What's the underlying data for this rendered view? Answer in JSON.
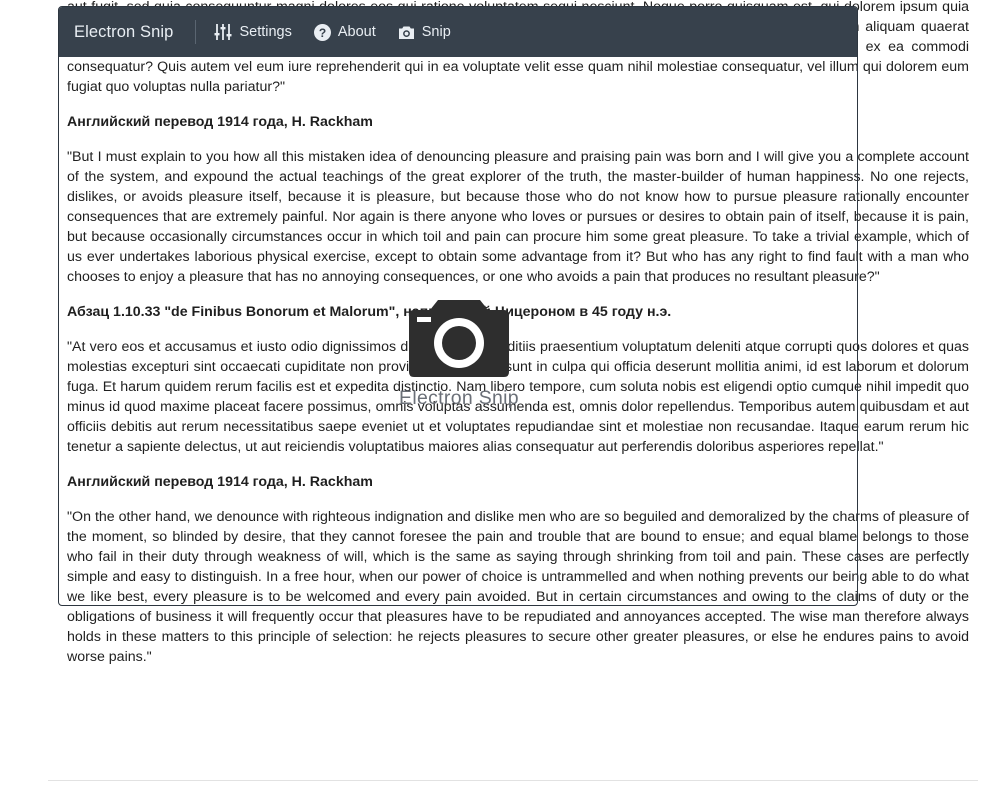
{
  "document": {
    "paragraphs": [
      {
        "type": "p",
        "text": "\"Sed ut perspiciatis unde omnis iste natus error sit voluptatem accusantium doloremque laudantium, totam rem aperiam, eaque ipsa quae ab illo inventore veritatis et quasi architecto beatae vitae dicta sunt explicabo. Nemo enim ipsam voluptatem quia voluptas sit aspernatur aut odit aut fugit, sed quia consequuntur magni dolores eos qui ratione voluptatem sequi nesciunt. Neque porro quisquam est, qui dolorem ipsum quia dolor sit amet, consectetur, adipisci velit, sed quia non numquam eius modi tempora incidunt ut labore et dolore magnam aliquam quaerat voluptatem. Ut enim ad minima veniam, quis nostrum exercitationem ullam corporis suscipit laboriosam, nisi ut aliquid ex ea commodi consequatur? Quis autem vel eum iure reprehenderit qui in ea voluptate velit esse quam nihil molestiae consequatur, vel illum qui dolorem eum fugiat quo voluptas nulla pariatur?\""
      },
      {
        "type": "h",
        "text": "Английский перевод 1914 года, H. Rackham"
      },
      {
        "type": "p",
        "text": "\"But I must explain to you how all this mistaken idea of denouncing pleasure and praising pain was born and I will give you a complete account of the system, and expound the actual teachings of the great explorer of the truth, the master-builder of human happiness. No one rejects, dislikes, or avoids pleasure itself, because it is pleasure, but because those who do not know how to pursue pleasure rationally encounter consequences that are extremely painful. Nor again is there anyone who loves or pursues or desires to obtain pain of itself, because it is pain, but because occasionally circumstances occur in which toil and pain can procure him some great pleasure. To take a trivial example, which of us ever undertakes laborious physical exercise, except to obtain some advantage from it? But who has any right to find fault with a man who chooses to enjoy a pleasure that has no annoying consequences, or one who avoids a pain that produces no resultant pleasure?\""
      },
      {
        "type": "h",
        "text": "Абзац 1.10.33 \"de Finibus Bonorum et Malorum\", написанный Цицероном в 45 году н.э."
      },
      {
        "type": "p",
        "text": "\"At vero eos et accusamus et iusto odio dignissimos ducimus qui blanditiis praesentium voluptatum deleniti atque corrupti quos dolores et quas molestias excepturi sint occaecati cupiditate non provident, similique sunt in culpa qui officia deserunt mollitia animi, id est laborum et dolorum fuga. Et harum quidem rerum facilis est et expedita distinctio. Nam libero tempore, cum soluta nobis est eligendi optio cumque nihil impedit quo minus id quod maxime placeat facere possimus, omnis voluptas assumenda est, omnis dolor repellendus. Temporibus autem quibusdam et aut officiis debitis aut rerum necessitatibus saepe eveniet ut et voluptates repudiandae sint et molestiae non recusandae. Itaque earum rerum hic tenetur a sapiente delectus, ut aut reiciendis voluptatibus maiores alias consequatur aut perferendis doloribus asperiores repellat.\""
      },
      {
        "type": "h",
        "text": "Английский перевод 1914 года, H. Rackham"
      },
      {
        "type": "p",
        "text": "\"On the other hand, we denounce with righteous indignation and dislike men who are so beguiled and demoralized by the charms of pleasure of the moment, so blinded by desire, that they cannot foresee the pain and trouble that are bound to ensue; and equal blame belongs to those who fail in their duty through weakness of will, which is the same as saying through shrinking from toil and pain. These cases are perfectly simple and easy to distinguish. In a free hour, when our power of choice is untrammelled and when nothing prevents our being able to do what we like best, every pleasure is to be welcomed and every pain avoided. But in certain circumstances and owing to the claims of duty or the obligations of business it will frequently occur that pleasures have to be repudiated and annoyances accepted. The wise man therefore always holds in these matters to this principle of selection: he rejects pleasures to secure other greater pleasures, or else he endures pains to avoid worse pains.\""
      }
    ]
  },
  "snip": {
    "app_title": "Electron Snip",
    "toolbar": {
      "settings_label": "Settings",
      "settings_icon": "sliders-icon",
      "about_label": "About",
      "about_icon": "help-circle-icon",
      "snip_label": "Snip",
      "snip_icon": "camera-icon"
    },
    "center_title": "Electron Snip",
    "center_icon": "camera-icon",
    "colors": {
      "toolbar_bg": "#37414c",
      "toolbar_text": "#e9eef3",
      "logo": "#2e2e2e"
    }
  }
}
